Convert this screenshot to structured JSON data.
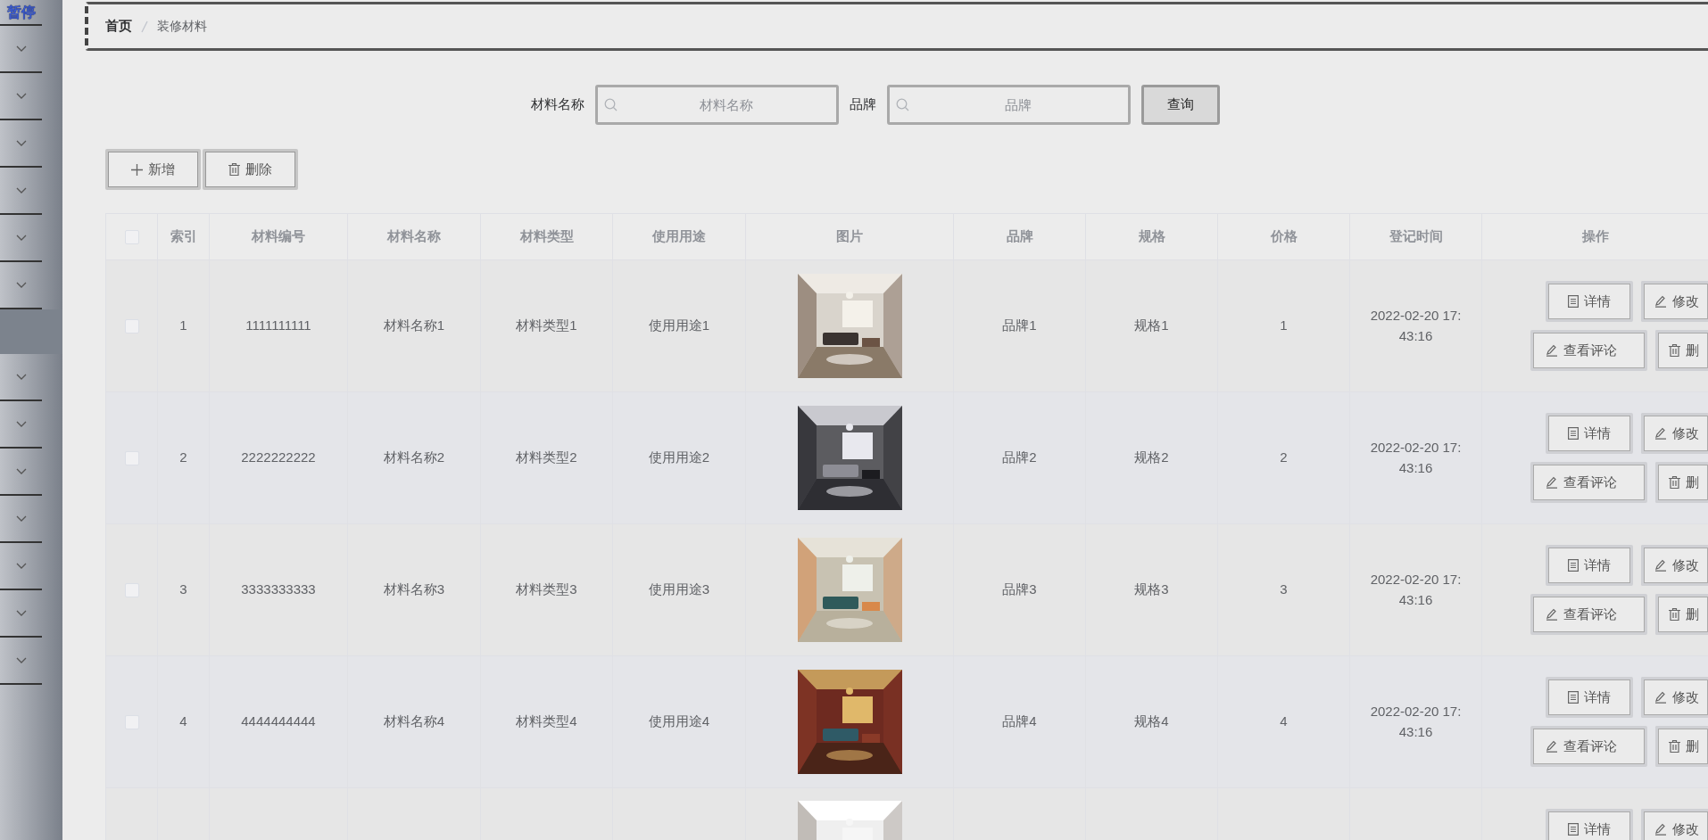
{
  "sidebar": {
    "title": "暂停",
    "items": [
      {
        "selected": false
      },
      {
        "selected": false
      },
      {
        "selected": false
      },
      {
        "selected": false
      },
      {
        "selected": false
      },
      {
        "selected": false
      },
      {
        "selected": true
      },
      {
        "selected": false
      },
      {
        "selected": false
      },
      {
        "selected": false
      },
      {
        "selected": false
      },
      {
        "selected": false
      },
      {
        "selected": false
      },
      {
        "selected": false
      }
    ]
  },
  "breadcrumb": [
    "首页",
    "装修材料"
  ],
  "search": {
    "fields": [
      {
        "label": "材料名称",
        "placeholder": "材料名称"
      },
      {
        "label": "品牌",
        "placeholder": "品牌"
      }
    ],
    "button": "查询"
  },
  "toolbar": [
    {
      "kind": "add",
      "label": "新增"
    },
    {
      "kind": "delete",
      "label": "删除"
    }
  ],
  "table": {
    "header_checked": false,
    "columns": [
      "索引",
      "材料编号",
      "材料名称",
      "材料类型",
      "使用用途",
      "图片",
      "品牌",
      "规格",
      "价格",
      "登记时间",
      "操作"
    ],
    "rows": [
      {
        "kind": "full",
        "checked": false,
        "cells": [
          "1",
          "1111111111",
          "材料名称1",
          "材料类型1",
          "使用用途1",
          "品牌1",
          "规格1",
          "1",
          "2022-02-20 17:43:16"
        ],
        "actions": [
          {
            "kind": "detail",
            "label": "详情"
          },
          {
            "kind": "edit",
            "label": "修改"
          },
          {
            "kind": "comment",
            "label": "查看评论"
          },
          {
            "kind": "delete",
            "label": "删"
          }
        ]
      },
      {
        "kind": "full",
        "checked": false,
        "cells": [
          "2",
          "2222222222",
          "材料名称2",
          "材料类型2",
          "使用用途2",
          "品牌2",
          "规格2",
          "2",
          "2022-02-20 17:43:16"
        ],
        "actions": [
          {
            "kind": "detail",
            "label": "详情"
          },
          {
            "kind": "edit",
            "label": "修改"
          },
          {
            "kind": "comment",
            "label": "查看评论"
          },
          {
            "kind": "delete",
            "label": "删"
          }
        ]
      },
      {
        "kind": "full",
        "checked": false,
        "cells": [
          "3",
          "3333333333",
          "材料名称3",
          "材料类型3",
          "使用用途3",
          "品牌3",
          "规格3",
          "3",
          "2022-02-20 17:43:16"
        ],
        "actions": [
          {
            "kind": "detail",
            "label": "详情"
          },
          {
            "kind": "edit",
            "label": "修改"
          },
          {
            "kind": "comment",
            "label": "查看评论"
          },
          {
            "kind": "delete",
            "label": "删"
          }
        ]
      },
      {
        "kind": "full",
        "checked": false,
        "cells": [
          "4",
          "4444444444",
          "材料名称4",
          "材料类型4",
          "使用用途4",
          "品牌4",
          "规格4",
          "4",
          "2022-02-20 17:43:16"
        ],
        "actions": [
          {
            "kind": "detail",
            "label": "详情"
          },
          {
            "kind": "edit",
            "label": "修改"
          },
          {
            "kind": "comment",
            "label": "查看评论"
          },
          {
            "kind": "delete",
            "label": "删"
          }
        ]
      },
      {
        "kind": "partial",
        "actions": [
          {
            "kind": "detail",
            "label": "详情"
          },
          {
            "kind": "edit",
            "label": "修改"
          }
        ]
      }
    ]
  }
}
